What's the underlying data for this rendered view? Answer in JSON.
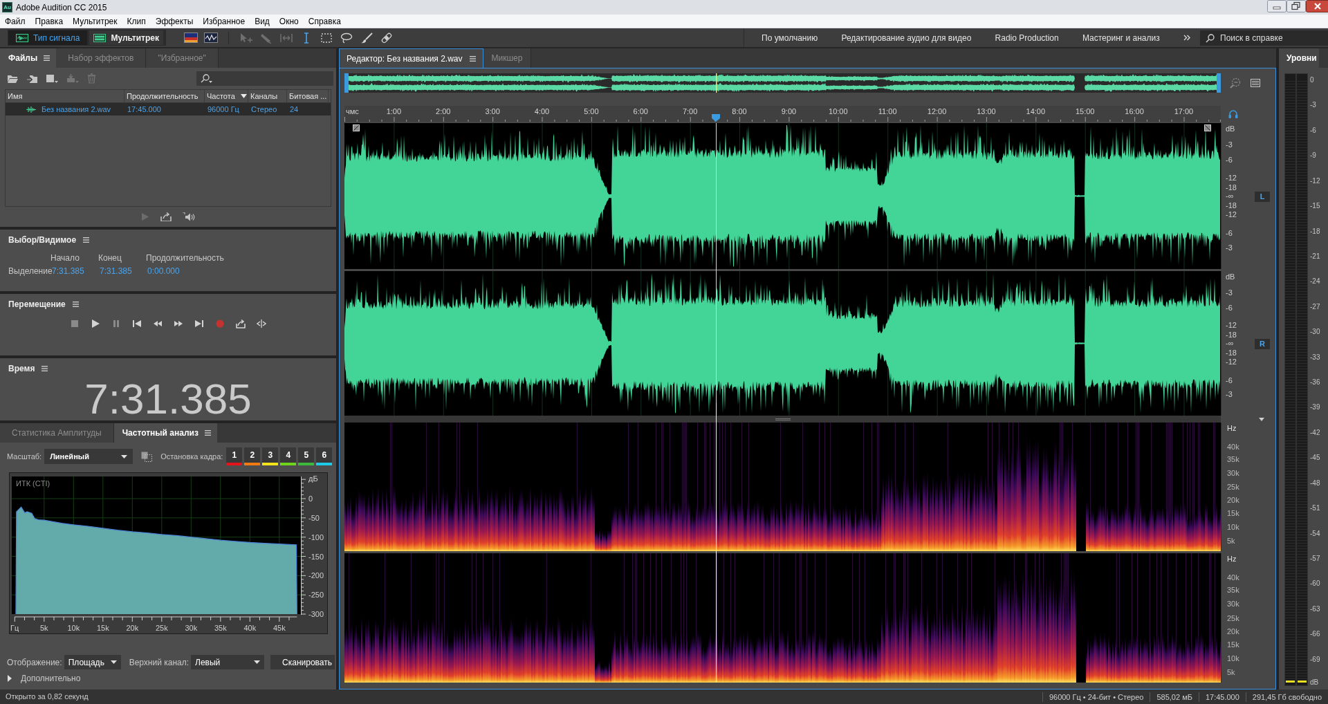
{
  "window": {
    "icon_text": "Au",
    "title": "Adobe Audition CC 2015"
  },
  "menu": [
    "Файл",
    "Правка",
    "Мультитрек",
    "Клип",
    "Эффекты",
    "Избранное",
    "Вид",
    "Окно",
    "Справка"
  ],
  "toolbar": {
    "modes": [
      {
        "label": "Тип сигнала",
        "selected": true
      },
      {
        "label": "Мультитрек",
        "selected": false
      }
    ],
    "tools": [
      {
        "selected": false,
        "disabled": true
      },
      {
        "selected": false,
        "disabled": true
      },
      {
        "selected": false,
        "disabled": true
      },
      {
        "selected": true,
        "disabled": false
      },
      {
        "selected": false,
        "disabled": false
      },
      {
        "selected": false,
        "disabled": false
      },
      {
        "selected": false,
        "disabled": false
      },
      {
        "selected": false,
        "disabled": false
      }
    ],
    "workspaces": [
      "По умолчанию",
      "Редактирование аудио для видео",
      "Radio Production",
      "Мастеринг и анализ"
    ],
    "search": {
      "placeholder": "Поиск в справке"
    }
  },
  "files_panel": {
    "tabs": [
      {
        "label": "Файлы",
        "selected": true
      },
      {
        "label": "Набор эффектов",
        "selected": false
      },
      {
        "label": "\"Избранное\"",
        "selected": false
      }
    ],
    "actions": [
      {
        "disabled": false
      },
      {
        "disabled": false
      },
      {
        "disabled": false
      },
      {
        "disabled": true
      },
      {
        "disabled": true
      }
    ],
    "columns": [
      {
        "label": "Имя",
        "sorted": false
      },
      {
        "label": "Продолжительность",
        "sorted": false
      },
      {
        "label": "Частота",
        "sorted": true
      },
      {
        "label": "Каналы",
        "sorted": false
      },
      {
        "label": "Битовая ...",
        "sorted": false
      }
    ],
    "rows": [
      {
        "cells": [
          "Без названия 2.wav",
          "17:45.000",
          "96000 Гц",
          "Стерео",
          "24"
        ],
        "selected": true
      }
    ],
    "preview": [
      {
        "disabled": true
      },
      {
        "disabled": false
      },
      {
        "disabled": false
      }
    ]
  },
  "selection_panel": {
    "title": "Выбор/Видимое",
    "columns": [
      "Начало",
      "Конец",
      "Продолжительность"
    ],
    "rows": [
      {
        "label": "Выделение",
        "values": [
          "7:31.385",
          "7:31.385",
          "0:00.000"
        ]
      }
    ]
  },
  "transport_panel": {
    "title": "Перемещение",
    "buttons": [
      {
        "disabled": true
      },
      {
        "disabled": false
      },
      {
        "disabled": true
      },
      {
        "disabled": false
      },
      {
        "disabled": false
      },
      {
        "disabled": false
      },
      {
        "disabled": false
      },
      {
        "disabled": false
      },
      {
        "disabled": false
      },
      {
        "disabled": false
      }
    ]
  },
  "time_panel": {
    "title": "Время",
    "value": "7:31.385"
  },
  "analysis_panel": {
    "tabs": [
      {
        "label": "Статистика Амплитуды",
        "selected": false
      },
      {
        "label": "Частотный анализ",
        "selected": true
      }
    ],
    "scale": {
      "label": "Масштаб:",
      "value": "Линейный"
    },
    "freeze": {
      "label": "Остановка кадра:",
      "buttons": [
        {
          "label": "1",
          "color": "#e5141b"
        },
        {
          "label": "2",
          "color": "#f27a12"
        },
        {
          "label": "3",
          "color": "#f2e41a"
        },
        {
          "label": "4",
          "color": "#70d41c"
        },
        {
          "label": "5",
          "color": "#3cb83c"
        },
        {
          "label": "6",
          "color": "#1ccbe8"
        }
      ]
    },
    "chart_data": {
      "type": "area",
      "title": "ИТК (CTI)",
      "xlabel": "Гц",
      "ylabel": "дБ",
      "x": [
        0.2,
        0.3,
        1.1,
        1.7,
        2.1,
        2.9,
        3.4,
        4,
        5,
        6.5,
        8,
        10,
        12.5,
        15,
        17.5,
        20,
        22.5,
        25,
        27.5,
        30,
        32.5,
        35,
        37.5,
        40,
        42.5,
        45,
        47.9,
        48
      ],
      "series": [
        {
          "color": "#63abab",
          "values": [
            -300,
            -34,
            -22,
            -37,
            -34,
            -38,
            -52,
            -55,
            -56,
            -60,
            -64,
            -68,
            -72,
            -77,
            -82,
            -86,
            -89,
            -93,
            -96,
            -100,
            -104,
            -108,
            -111,
            -114,
            -116,
            -118,
            -120,
            -300
          ]
        }
      ],
      "xlim": [
        0,
        48
      ],
      "ylim": [
        -300,
        57
      ],
      "xticks": [
        {
          "value": 5,
          "label": "5k"
        },
        {
          "value": 10,
          "label": "10k"
        },
        {
          "value": 15,
          "label": "15k"
        },
        {
          "value": 20,
          "label": "20k"
        },
        {
          "value": 25,
          "label": "25k"
        },
        {
          "value": 30,
          "label": "30k"
        },
        {
          "value": 35,
          "label": "35k"
        },
        {
          "value": 40,
          "label": "40k"
        },
        {
          "value": 45,
          "label": "45k"
        }
      ],
      "yticks": [
        0,
        -50,
        -100,
        -150,
        -200,
        -250,
        -300
      ],
      "grid": true
    },
    "display": {
      "label": "Отображение:",
      "value": "Площадь"
    },
    "channel": {
      "label": "Верхний канал:",
      "value": "Левый"
    },
    "scan_button": "Сканировать",
    "advanced": {
      "label": "Дополнительно",
      "expanded": false
    }
  },
  "editor": {
    "tabs": [
      {
        "label": "Редактор: Без названия 2.wav",
        "selected": true
      },
      {
        "label": "Микшер",
        "selected": false
      }
    ],
    "playhead": {
      "level": 0.4238
    },
    "ruler": [
      "чмс",
      "1:00",
      "2:00",
      "3:00",
      "4:00",
      "5:00",
      "6:00",
      "7:00",
      "8:00",
      "9:00",
      "10:00",
      "11:00",
      "12:00",
      "13:00",
      "14:00",
      "15:00",
      "16:00",
      "17:00"
    ],
    "channels": [
      {
        "badge": "L",
        "db_scale": [
          "dB",
          "-3",
          "-6",
          "-12",
          "-18",
          "-∞",
          "-18",
          "-12",
          "-6",
          "-3"
        ]
      },
      {
        "badge": "R",
        "db_scale": [
          "dB",
          "-3",
          "-6",
          "-12",
          "-18",
          "-∞",
          "-18",
          "-12",
          "-6",
          "-3"
        ]
      }
    ],
    "spectral_scales": [
      [
        "Hz",
        "40k",
        "35k",
        "30k",
        "25k",
        "20k",
        "15k",
        "10k",
        "5k"
      ],
      [
        "Hz",
        "40k",
        "35k",
        "30k",
        "25k",
        "20k",
        "15k",
        "10k",
        "5k"
      ]
    ]
  },
  "levels_panel": {
    "title": "Уровни",
    "scale": [
      "0",
      "-3",
      "-6",
      "-9",
      "-12",
      "-15",
      "-18",
      "-21",
      "-24",
      "-27",
      "-30",
      "-33",
      "-36",
      "-39",
      "-42",
      "-45",
      "-48",
      "-51",
      "-54",
      "-57",
      "-60",
      "-63",
      "-66",
      "-69"
    ],
    "unit": "dB"
  },
  "status_bar": {
    "message": "Открыто за 0,82 секунд",
    "items": [
      "96000 Гц • 24-бит • Стерео",
      "585,02 мБ",
      "17:45.000",
      "291,45 Гб свободно"
    ]
  }
}
